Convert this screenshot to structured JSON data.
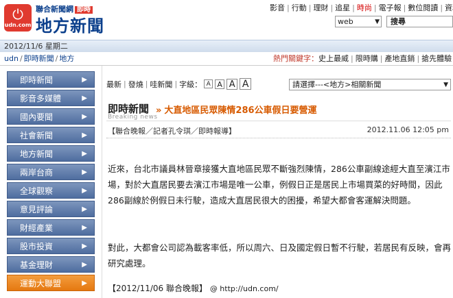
{
  "header": {
    "brand_top": "聯合新聞網",
    "brand_badge": "即時",
    "brand_main": "地方新聞",
    "logo_text": "udn.com",
    "topnav": [
      "影音",
      "行動",
      "理財",
      "追星",
      "時尚",
      "電子報",
      "數位閱讀",
      "資料庫"
    ],
    "topnav_hot_index": 4,
    "search_scope": "web",
    "search_button": "搜尋"
  },
  "datebar": {
    "date": "2012/11/6 星期二"
  },
  "breadcrumb": [
    "udn",
    "即時新聞",
    "地方"
  ],
  "hot_keywords": {
    "label": "熱門關鍵字：",
    "items": [
      "史上最威",
      "限時購",
      "產地直銷",
      "搶先體驗"
    ]
  },
  "sidebar": [
    {
      "label": "即時新聞",
      "highlight": false
    },
    {
      "label": "影音多媒體",
      "highlight": false
    },
    {
      "label": "國內要聞",
      "highlight": false
    },
    {
      "label": "社會新聞",
      "highlight": false
    },
    {
      "label": "地方新聞",
      "highlight": false
    },
    {
      "label": "兩岸台商",
      "highlight": false
    },
    {
      "label": "全球觀察",
      "highlight": false
    },
    {
      "label": "意見評論",
      "highlight": false
    },
    {
      "label": "財經產業",
      "highlight": false
    },
    {
      "label": "股市投資",
      "highlight": false
    },
    {
      "label": "基金理財",
      "highlight": false
    },
    {
      "label": "運動大聯盟",
      "highlight": true
    }
  ],
  "toolbar": {
    "items": [
      "最新",
      "發燒",
      "哇新聞"
    ],
    "font_label": "字級：",
    "font_sizes": [
      "A",
      "A",
      "A",
      "A"
    ]
  },
  "related_select": "請選擇---<地方>相關新聞",
  "article": {
    "section_label": "即時新聞",
    "section_sub": "Breaking news",
    "title": "大直地區民眾陳情286公車假日要營運",
    "byline": "【聯合晚報／記者孔令琪／即時報導】",
    "time": "2012.11.06 12:05 pm",
    "para1": "近來，台北市議員林晉章接獲大直地區民眾不斷強烈陳情，286公車副線途經大直至濱江市場，對於大直居民要去濱江市場是唯一公車，例假日正是居民上市場買菜的好時間，因此286副線於例假日未行駛，造成大直居民很大的困擾，希望大都會客運解決問題。",
    "para2": "對此，大都會公司認為載客率低，所以周六、日及國定假日暫不行駛，若居民有反映，會再研究處理。",
    "source": "【2012/11/06 聯合晚報】",
    "url": "@ http://udn.com/"
  }
}
